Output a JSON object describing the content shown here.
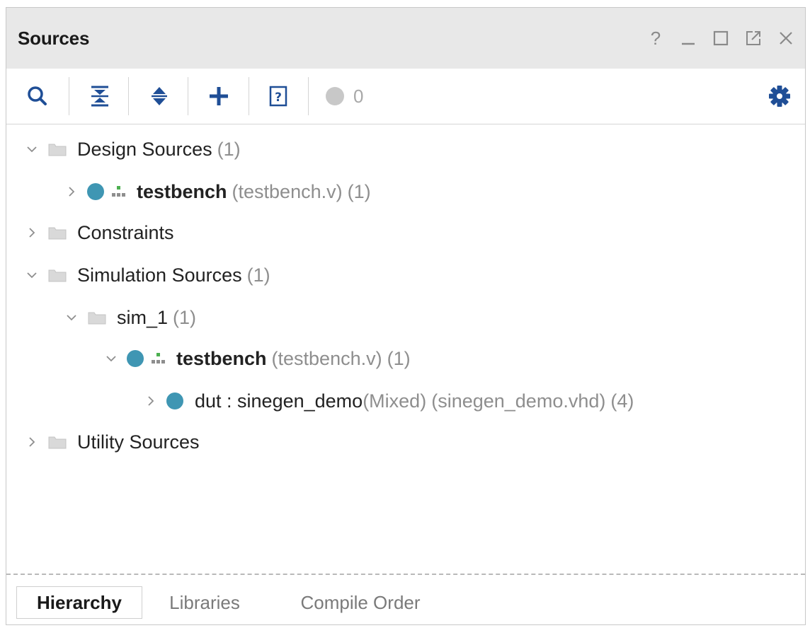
{
  "panel": {
    "title": "Sources",
    "window_controls": {
      "help_label": "?",
      "minimize_label": "_"
    }
  },
  "toolbar": {
    "items": [
      "search-icon",
      "collapse-all-icon",
      "expand-all-icon",
      "add-icon",
      "unknown-file-icon",
      "status-circle-icon",
      "gear-icon"
    ],
    "status_count": "0"
  },
  "tree": {
    "design_sources": {
      "label": "Design Sources",
      "count": "(1)"
    },
    "design_testbench": {
      "label": "testbench",
      "file": "(testbench.v)",
      "count": "(1)"
    },
    "constraints": {
      "label": "Constraints"
    },
    "simulation_sources": {
      "label": "Simulation Sources",
      "count": "(1)"
    },
    "sim_1": {
      "label": "sim_1",
      "count": "(1)"
    },
    "sim_testbench": {
      "label": "testbench",
      "file": "(testbench.v)",
      "count": "(1)"
    },
    "dut": {
      "label": "dut : sinegen_demo",
      "kind": "(Mixed)",
      "file": "(sinegen_demo.vhd)",
      "count": "(4)"
    },
    "utility_sources": {
      "label": "Utility Sources"
    }
  },
  "tabs": {
    "hierarchy": "Hierarchy",
    "libraries": "Libraries",
    "compile_order": "Compile Order",
    "active": "Hierarchy"
  },
  "colors": {
    "accent_dot": "#3f96b3",
    "icon_blue": "#1f4e96",
    "hier_green": "#4caf50"
  }
}
